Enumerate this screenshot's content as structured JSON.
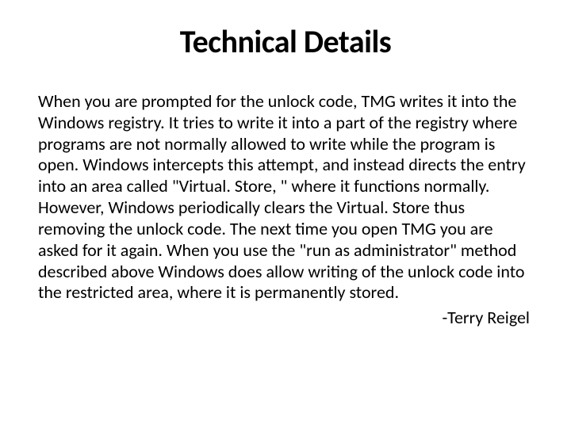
{
  "slide": {
    "title": "Technical Details",
    "body": "When you are prompted for the unlock code, TMG writes it into the Windows registry. It tries to write it into a part of the registry where programs are not normally allowed to write while the program is open. Windows intercepts this attempt, and instead directs the entry into an area called \"Virtual. Store, \" where it functions normally. However, Windows periodically clears the Virtual. Store thus removing the unlock code. The next time you open TMG you are asked for it again. When you use the \"run as administrator\" method described above Windows does allow writing of the unlock code into the restricted area, where it is permanently stored.",
    "attribution": "-Terry Reigel"
  }
}
